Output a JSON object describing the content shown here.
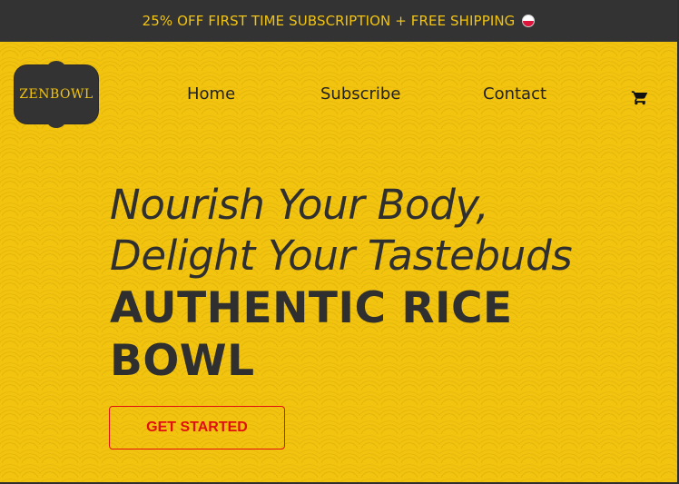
{
  "promo": {
    "text": "25% OFF FIRST TIME SUBSCRIPTION + FREE SHIPPING",
    "icon": "flag-icon"
  },
  "logo": {
    "text": "ZENBOWL"
  },
  "nav": {
    "items": [
      {
        "label": "Home"
      },
      {
        "label": "Subscribe"
      },
      {
        "label": "Contact"
      }
    ],
    "cart_icon": "cart-icon"
  },
  "hero": {
    "tagline_line1": "Nourish Your Body,",
    "tagline_line2": "Delight Your Tastebuds",
    "title_line1": "AUTHENTIC RICE",
    "title_line2": "BOWL",
    "cta_label": "GET STARTED"
  },
  "colors": {
    "accent": "#f2c40f",
    "dark": "#333333",
    "cta": "#e01010"
  }
}
